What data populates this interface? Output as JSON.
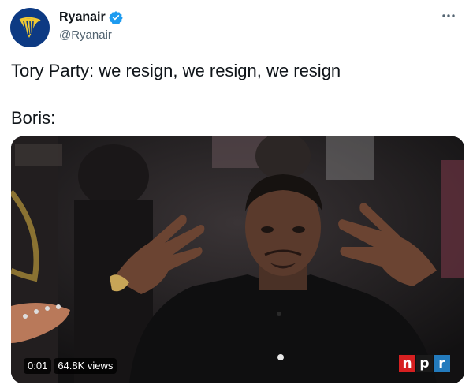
{
  "account": {
    "display_name": "Ryanair",
    "handle": "@Ryanair",
    "avatar_icon": "harp-logo-icon",
    "verified_icon": "verified-badge-icon",
    "more_icon": "more-options-icon"
  },
  "tweet": {
    "text": "Tory Party: we resign, we resign, we resign\n\nBoris:"
  },
  "media": {
    "type": "video",
    "time": "0:01",
    "views": "64.8K views",
    "watermark_letters": [
      "n",
      "p",
      "r"
    ],
    "watermark_colors": [
      "#d62021",
      "#1a1a1a",
      "#237bbd"
    ]
  },
  "colors": {
    "text": "#0f1419",
    "secondary": "#536471",
    "verified": "#1d9bf0",
    "avatar_bg": "#0d3a83",
    "logo": "#f1c933"
  }
}
